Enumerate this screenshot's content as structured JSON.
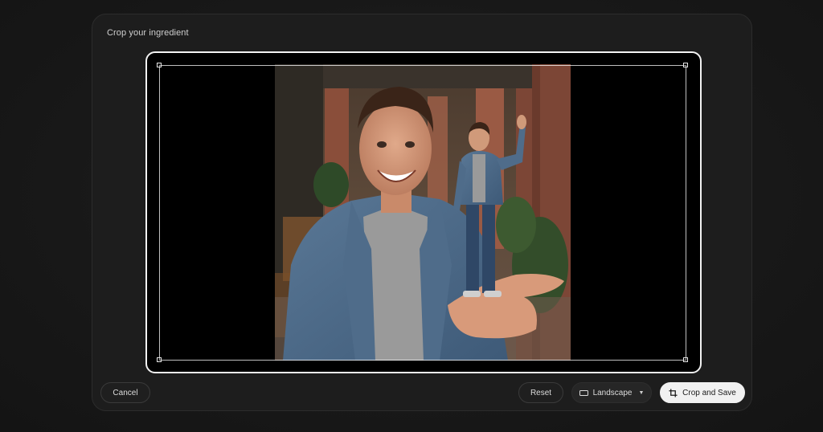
{
  "dialog": {
    "title": "Crop your ingredient"
  },
  "footer": {
    "cancel_label": "Cancel",
    "reset_label": "Reset",
    "aspect_label": "Landscape",
    "save_label": "Crop and Save"
  },
  "icons": {
    "aspect": "landscape-rect-icon",
    "dropdown": "chevron-down-icon",
    "save": "crop-icon"
  },
  "colors": {
    "background": "#161616",
    "dialog": "#1d1d1d",
    "frame_border": "#f2f2f2",
    "save_button": "#f1f1f1"
  }
}
